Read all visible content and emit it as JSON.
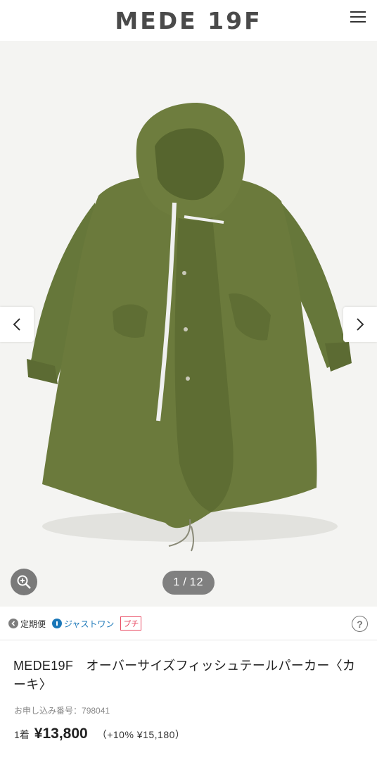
{
  "header": {
    "logo": "MEDE 19F",
    "menu_icon": "hamburger-menu-icon"
  },
  "gallery": {
    "image_alt": "khaki fishtail parka",
    "counter_current": "1",
    "counter_separator": "/",
    "counter_total": "12",
    "prev_icon": "chevron-left-icon",
    "next_icon": "chevron-right-icon",
    "zoom_icon": "zoom-in-icon"
  },
  "badges": {
    "teikibin": "定期便",
    "justone": "ジャストワン",
    "puchi": "プチ",
    "help": "?"
  },
  "product": {
    "title": "MEDE19F　オーバーサイズフィッシュテールパーカー〈カーキ〉",
    "order_label": "お申し込み番号：",
    "order_number": "798041",
    "unit": "1着",
    "price": "¥13,800",
    "tax": "（+10% ¥15,180）"
  },
  "colors": {
    "khaki": "#6b7a3c",
    "brand_gray": "#4a4a4a",
    "justone_blue": "#1a77b8",
    "puchi_red": "#e94c64"
  }
}
